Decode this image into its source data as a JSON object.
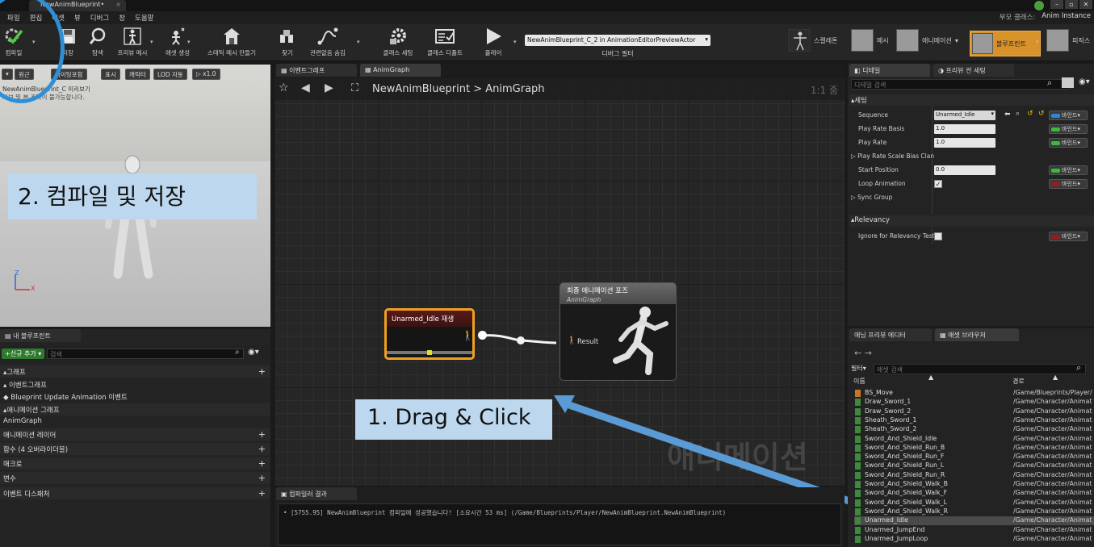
{
  "window": {
    "doc_tab": "NewAnimBlueprint•",
    "controls": [
      "–",
      "▫",
      "✕"
    ]
  },
  "menu": {
    "items": [
      "파일",
      "편집",
      "애셋",
      "뷰",
      "디버그",
      "창",
      "도움말"
    ],
    "right_parent_class_label": "부모 클래스:",
    "right_parent_class_value": "Anim Instance"
  },
  "toolbar": {
    "buttons": [
      {
        "label": "컴파일",
        "icon": "compile-icon"
      },
      {
        "label": "저장",
        "icon": "save-icon"
      },
      {
        "label": "탐색",
        "icon": "browse-icon"
      },
      {
        "label": "프리뷰 메시",
        "icon": "preview-mesh-icon"
      },
      {
        "label": "애셋 생성",
        "icon": "create-asset-icon"
      },
      {
        "label": "스태틱 메시 만들기",
        "icon": "static-mesh-icon"
      },
      {
        "label": "찾기",
        "icon": "find-icon"
      },
      {
        "label": "관련없음 숨김",
        "icon": "hide-unrelated-icon"
      },
      {
        "label": "클래스 세팅",
        "icon": "class-settings-icon"
      },
      {
        "label": "클래스 디폴트",
        "icon": "class-defaults-icon"
      },
      {
        "label": "플레이",
        "icon": "play-icon"
      }
    ],
    "debug_filter_value": "NewAnimBlueprint_C_2 in AnimationEditorPreviewActor",
    "debug_filter_label": "디버그 필터",
    "modes": [
      {
        "label": "스켈레톤"
      },
      {
        "label": "메시"
      },
      {
        "label": "애니메이션"
      },
      {
        "label": "블루프린트"
      },
      {
        "label": "피직스"
      }
    ]
  },
  "viewport": {
    "buttons": [
      "▾",
      "원근",
      "라이팅포함",
      "표시",
      "캐릭터",
      "LOD 자동",
      "▷ x1.0"
    ],
    "info_line1": "NewAnimBlueprint_C 미리보기",
    "info_line2": "커브 및 본 조작이 불가능합니다.",
    "axis_z": "Z",
    "axis_x": "X"
  },
  "annotations": {
    "step2": "2. 컴파일 및 저장",
    "step1": "1. Drag & Click"
  },
  "myblueprint": {
    "tab": "내 블루프린트",
    "add_new": "+신규 추가 ▾",
    "search_placeholder": "검색",
    "rows": [
      {
        "label": "▴그래프",
        "section": true,
        "plus": true
      },
      {
        "label": "  ▴ 이벤트그래프",
        "section": false,
        "plus": false
      },
      {
        "label": "      ◆ Blueprint Update Animation 이벤트",
        "section": false,
        "plus": false
      },
      {
        "label": "▴애니메이션 그래프",
        "section": true,
        "plus": false
      },
      {
        "label": "    AnimGraph",
        "section": false,
        "plus": false
      },
      {
        "label": "애니메이션 레이어",
        "section": true,
        "plus": true
      },
      {
        "label": "함수 (4 오버라이더블)",
        "section": true,
        "plus": true
      },
      {
        "label": "매크로",
        "section": true,
        "plus": true
      },
      {
        "label": "변수",
        "section": true,
        "plus": true
      },
      {
        "label": "이벤트 디스패처",
        "section": true,
        "plus": true
      }
    ]
  },
  "graph": {
    "tabs": [
      "이벤트그래프",
      "AnimGraph"
    ],
    "breadcrumb_root": "NewAnimBlueprint",
    "breadcrumb_sep": ">",
    "breadcrumb_leaf": "AnimGraph",
    "zoom": "1:1 줌",
    "watermark": "애니메이션",
    "node_idle_title": "Unarmed_Idle 재생",
    "node_final_title": "최종 애니메이션 포즈",
    "node_final_subtitle": "AnimGraph",
    "node_final_pin": "Result"
  },
  "compiler": {
    "tab": "컴파일러 결과",
    "message": "• [5755.95] NewAnimBlueprint 컴파일에 성공했습니다! [소요시간 53 ms] (/Game/Blueprints/Player/NewAnimBlueprint.NewAnimBlueprint)"
  },
  "details": {
    "tabs": [
      "디테일",
      "프리뷰 씬 세팅"
    ],
    "search_placeholder": "디테일 검색",
    "cat_settings": "▴세팅",
    "cat_relevancy": "▴Relevancy",
    "bind_label": "바인드▾",
    "rows": [
      {
        "label": "Sequence",
        "value": "Unarmed_Idle",
        "type": "asset",
        "bind_color": "#2e86d9"
      },
      {
        "label": "Play Rate Basis",
        "value": "1.0",
        "type": "num",
        "bind_color": "#3cb83c"
      },
      {
        "label": "Play Rate",
        "value": "1.0",
        "type": "num",
        "bind_color": "#3cb83c"
      },
      {
        "label": "▷ Play Rate Scale Bias Clan",
        "value": "",
        "type": "none",
        "bind_color": ""
      },
      {
        "label": "Start Position",
        "value": "0.0",
        "type": "num",
        "bind_color": "#3cb83c"
      },
      {
        "label": "Loop Animation",
        "value": "✓",
        "type": "check",
        "bind_color": "#a01818"
      },
      {
        "label": "▷ Sync Group",
        "value": "",
        "type": "none",
        "bind_color": ""
      }
    ],
    "relevancy_row": {
      "label": "Ignore for Relevancy Test",
      "bind_color": "#a01818"
    }
  },
  "assetbrowser": {
    "tabs": [
      "애님 프리뷰 에디터",
      "애셋 브라우저"
    ],
    "filter": "필터▾",
    "search_placeholder": "애셋 검색",
    "col_name": "이름",
    "col_path": "경로",
    "items": [
      {
        "name": "BS_Move",
        "path": "/Game/Blueprints/Player/",
        "kind": "bs"
      },
      {
        "name": "Draw_Sword_1",
        "path": "/Game/Character/Animat",
        "kind": "anim"
      },
      {
        "name": "Draw_Sword_2",
        "path": "/Game/Character/Animat",
        "kind": "anim"
      },
      {
        "name": "Sheath_Sword_1",
        "path": "/Game/Character/Animat",
        "kind": "anim"
      },
      {
        "name": "Sheath_Sword_2",
        "path": "/Game/Character/Animat",
        "kind": "anim"
      },
      {
        "name": "Sword_And_Shield_Idle",
        "path": "/Game/Character/Animat",
        "kind": "anim"
      },
      {
        "name": "Sword_And_Shield_Run_B",
        "path": "/Game/Character/Animat",
        "kind": "anim"
      },
      {
        "name": "Sword_And_Shield_Run_F",
        "path": "/Game/Character/Animat",
        "kind": "anim"
      },
      {
        "name": "Sword_And_Shield_Run_L",
        "path": "/Game/Character/Animat",
        "kind": "anim"
      },
      {
        "name": "Sword_And_Shield_Run_R",
        "path": "/Game/Character/Animat",
        "kind": "anim"
      },
      {
        "name": "Sword_And_Shield_Walk_B",
        "path": "/Game/Character/Animat",
        "kind": "anim"
      },
      {
        "name": "Sword_And_Shield_Walk_F",
        "path": "/Game/Character/Animat",
        "kind": "anim"
      },
      {
        "name": "Sword_And_Shield_Walk_L",
        "path": "/Game/Character/Animat",
        "kind": "anim"
      },
      {
        "name": "Sword_And_Shield_Walk_R",
        "path": "/Game/Character/Animat",
        "kind": "anim"
      },
      {
        "name": "Unarmed_Idle",
        "path": "/Game/Character/Animat",
        "kind": "anim",
        "selected": true
      },
      {
        "name": "Unarmed_JumpEnd",
        "path": "/Game/Character/Animat",
        "kind": "anim"
      },
      {
        "name": "Unarmed_JumpLoop",
        "path": "/Game/Character/Animat",
        "kind": "anim"
      }
    ]
  },
  "colors": {
    "annotation_fill": "#bdd7ee",
    "annotation_arrow": "#5b9bd5",
    "highlight_circle": "#2e8fd6",
    "node_selected": "#f0a020"
  }
}
